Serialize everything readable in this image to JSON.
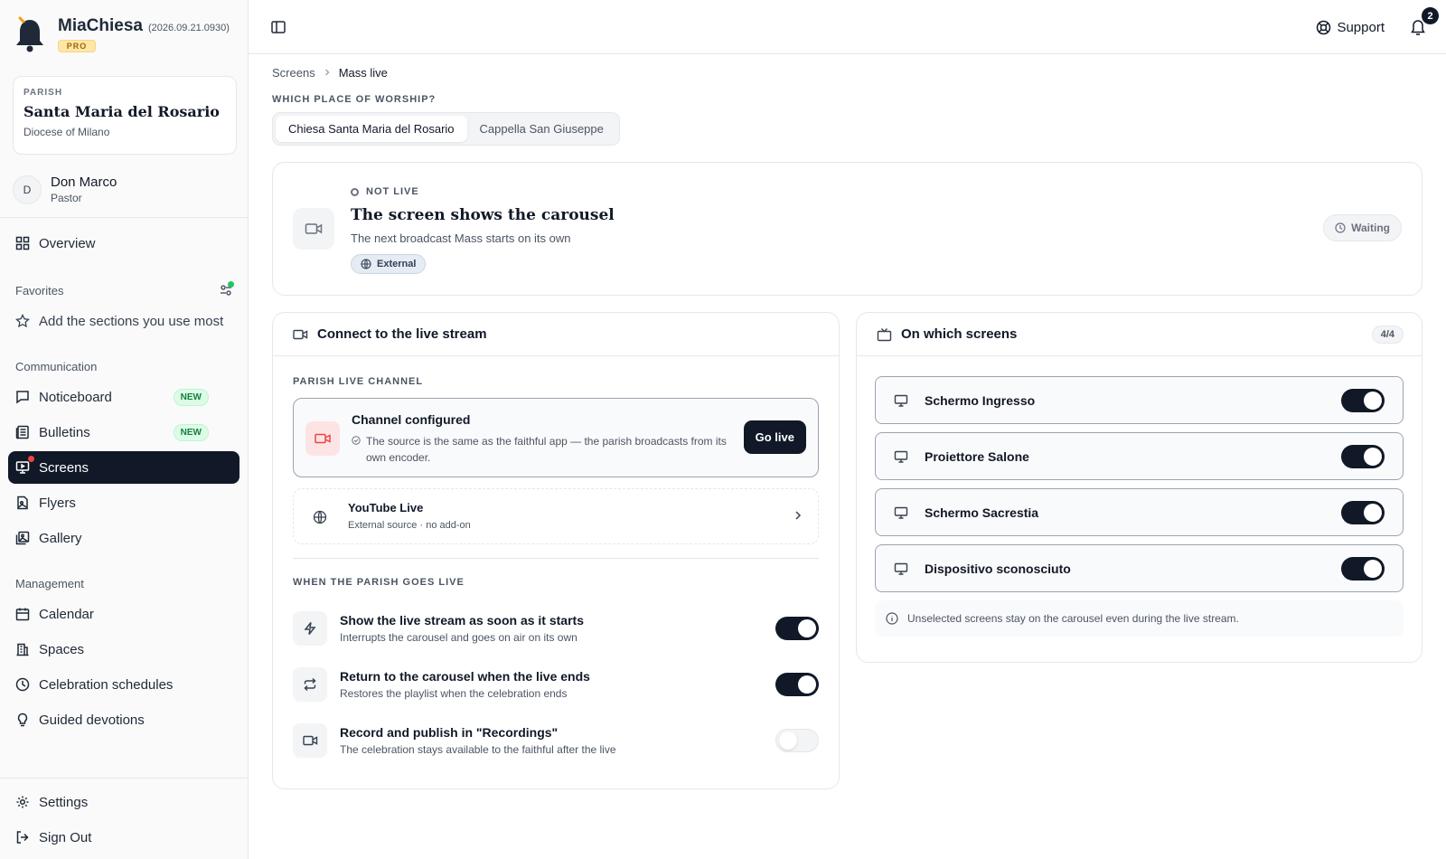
{
  "brand": {
    "name": "MiaChiesa",
    "version": "(2026.09.21.0930)",
    "tier": "PRO"
  },
  "parish": {
    "kicker": "PARISH",
    "name": "Santa Maria del Rosario",
    "diocese": "Diocese of Milano"
  },
  "user": {
    "initial": "D",
    "name": "Don Marco",
    "role": "Pastor"
  },
  "nav": {
    "overview": "Overview",
    "favorites_label": "Favorites",
    "favorites_add": "Add the sections you use most",
    "communication_label": "Communication",
    "noticeboard": "Noticeboard",
    "bulletins": "Bulletins",
    "screens": "Screens",
    "flyers": "Flyers",
    "gallery": "Gallery",
    "management_label": "Management",
    "calendar": "Calendar",
    "spaces": "Spaces",
    "schedules": "Celebration schedules",
    "devotions": "Guided devotions",
    "settings": "Settings",
    "signout": "Sign Out",
    "new_badge": "NEW"
  },
  "topbar": {
    "support": "Support",
    "notifications": "2"
  },
  "breadcrumb": {
    "parent": "Screens",
    "current": "Mass live"
  },
  "worship": {
    "label": "WHICH PLACE OF WORSHIP?",
    "options": [
      "Chiesa Santa Maria del Rosario",
      "Cappella San Giuseppe"
    ],
    "selected": "Chiesa Santa Maria del Rosario"
  },
  "status": {
    "kicker": "NOT LIVE",
    "title": "The screen shows the carousel",
    "subtitle": "The next broadcast Mass starts on its own",
    "source_chip": "External",
    "state_chip": "Waiting"
  },
  "connect": {
    "title": "Connect to the live stream",
    "channel_label": "PARISH LIVE CHANNEL",
    "channel_title": "Channel configured",
    "channel_desc": "The source is the same as the faithful app — the parish broadcasts from its own encoder.",
    "go_live": "Go live",
    "yt_title": "YouTube Live",
    "yt_sub": "External source · no add-on",
    "goes_live_label": "WHEN THE PARISH GOES LIVE",
    "options": [
      {
        "title": "Show the live stream as soon as it starts",
        "sub": "Interrupts the carousel and goes on air on its own",
        "on": true
      },
      {
        "title": "Return to the carousel when the live ends",
        "sub": "Restores the playlist when the celebration ends",
        "on": true
      },
      {
        "title": "Record and publish in \"Recordings\"",
        "sub": "The celebration stays available to the faithful after the live",
        "on": false
      }
    ]
  },
  "screens": {
    "title": "On which screens",
    "count": "4/4",
    "items": [
      {
        "name": "Schermo Ingresso",
        "on": true
      },
      {
        "name": "Proiettore Salone",
        "on": true
      },
      {
        "name": "Schermo Sacrestia",
        "on": true
      },
      {
        "name": "Dispositivo sconosciuto",
        "on": true
      }
    ],
    "note": "Unselected screens stay on the carousel even during the live stream."
  },
  "colors": {
    "accent": "#111827",
    "danger": "#ef4444",
    "success": "#22c55e",
    "pro": "#fde7a8"
  }
}
